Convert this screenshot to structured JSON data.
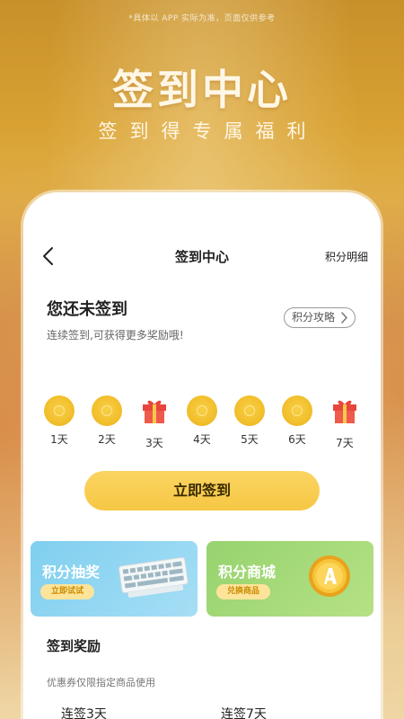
{
  "banner": {
    "disclaimer": "*具体以 APP 实际为准，页面仅供参考",
    "title": "签到中心",
    "subtitle": "签到得专属福利"
  },
  "nav": {
    "title": "签到中心",
    "right_label": "积分明细"
  },
  "status": {
    "title": "您还未签到",
    "description": "连续签到,可获得更多奖励哦!",
    "strategy_label": "积分攻略"
  },
  "days": [
    {
      "label": "1天",
      "reward": "coin"
    },
    {
      "label": "2天",
      "reward": "coin"
    },
    {
      "label": "3天",
      "reward": "gift"
    },
    {
      "label": "4天",
      "reward": "coin"
    },
    {
      "label": "5天",
      "reward": "coin"
    },
    {
      "label": "6天",
      "reward": "coin"
    },
    {
      "label": "7天",
      "reward": "gift"
    }
  ],
  "checkin_button": "立即签到",
  "cards": {
    "lottery": {
      "title": "积分抽奖",
      "button": "立即试试"
    },
    "mall": {
      "title": "积分商城",
      "button": "兑换商品"
    }
  },
  "rewards": {
    "title": "签到奖励",
    "note": "优惠券仅限指定商品使用",
    "tags": [
      "连签3天",
      "连签7天"
    ]
  },
  "colors": {
    "accent": "#f6c745",
    "coin": "#f2bf2c",
    "gift": "#e8453c",
    "lottery_card": "#8fd5f2",
    "mall_card": "#a2d878"
  }
}
